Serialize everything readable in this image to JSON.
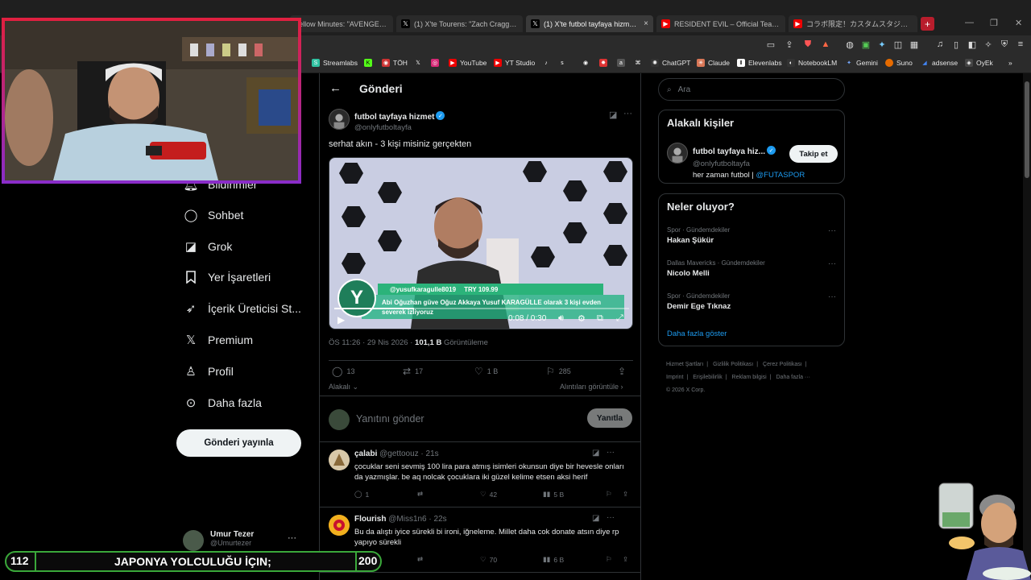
{
  "browser": {
    "tabs": [
      {
        "label": "Yellow Minutes: \"AVENGERS: D",
        "color": "#d33"
      },
      {
        "label": "(1) X'te Tourens: \"Zach Cragger, Resi",
        "color": "#222"
      },
      {
        "label": "(1) X'te futbol tayfaya hizmet: \"s",
        "color": "#222",
        "active": true
      },
      {
        "label": "RESIDENT EVIL – Official Teaser Trail",
        "color": "#e00"
      },
      {
        "label": "コラボ限定！カスタムスタジアムの映像を",
        "color": "#e00"
      }
    ],
    "tab_close": "×",
    "new_tab": "+",
    "bookmarks": [
      {
        "label": "Streamlabs",
        "color": "#31c3a2"
      },
      {
        "label": "TÖH",
        "color": "#c33"
      },
      {
        "label": "",
        "color": "#000"
      },
      {
        "label": "",
        "color": "#d62976"
      },
      {
        "label": "YouTube",
        "color": "#e00"
      },
      {
        "label": "YT Studio",
        "color": "#e00"
      },
      {
        "label": "ChatGPT",
        "color": "#333"
      },
      {
        "label": "Claude",
        "color": "#d97757"
      },
      {
        "label": "Elevenlabs",
        "color": "#333"
      },
      {
        "label": "NotebookLM",
        "color": "#333"
      },
      {
        "label": "Gemini",
        "color": "#4a86e8"
      },
      {
        "label": "Suno",
        "color": "#e66b00"
      },
      {
        "label": "adsense",
        "color": "#4285f4"
      },
      {
        "label": "OyEk",
        "color": "#444"
      }
    ],
    "bookmarks_overflow": "»"
  },
  "nav": {
    "items": [
      {
        "label": "Bildirimler",
        "icon": "🔔"
      },
      {
        "label": "Sohbet",
        "icon": "◯"
      },
      {
        "label": "Grok",
        "icon": "◪"
      },
      {
        "label": "Yer İşaretleri",
        "icon": "⚑"
      },
      {
        "label": "İçerik Üreticisi St...",
        "icon": "➶"
      },
      {
        "label": "Premium",
        "icon": "𝕏"
      },
      {
        "label": "Profil",
        "icon": "♙"
      },
      {
        "label": "Daha fazla",
        "icon": "⊙"
      }
    ],
    "post_button": "Gönderi yayınla",
    "account": {
      "name": "Umur Tezer",
      "handle": "@Umurtezer",
      "more": "···"
    }
  },
  "main": {
    "header_title": "Gönderi",
    "back_icon": "←",
    "post": {
      "author_name": "futbol tayfaya hizmet",
      "author_handle": "@onlyfutboltayfa",
      "text": "serhat akın - 3 kişi misiniz gerçekten",
      "video": {
        "banner_user": "@yusufkaragulle8019",
        "banner_amount": "TRY 109.99",
        "banner_message": "Abi Oğuzhan güve Oğuz Akkaya Yusuf KARAGÜLLE olarak 3 kişi evden severek izliyoruz",
        "banner_letter": "Y",
        "time": "0:08 / 0:30",
        "progress": 0.27
      },
      "timestamp": "ÖS 11:26 · 29 Nis 2026 · ",
      "views_count": "101,1 B",
      "views_label": " Görüntüleme",
      "actions": {
        "replies": "13",
        "reposts": "17",
        "likes": "1 B",
        "bookmarks": "285"
      },
      "relevant_label": "Alakalı ⌄",
      "quotes_link": "Alıntıları görüntüle ›"
    },
    "reply_box": {
      "placeholder": "Yanıtını gönder",
      "button": "Yanıtla"
    },
    "replies": [
      {
        "name": "çalabi",
        "meta": "@gettoouz · 21s",
        "text": "çocuklar seni sevmiş 100 lira para atmış isimleri okunsun diye bir hevesle onları da yazmışlar. be aq nolcak çocuklara iki güzel kelime etsen aksi herif",
        "replies": "1",
        "reposts": "",
        "likes": "42",
        "views": "5 B"
      },
      {
        "name": "Flourish",
        "meta": "@Miss1n6 · 22s",
        "text": "Bu da alıştı iyice sürekli bi ironi, iğneleme. Millet daha cok donate atsın diye rp yapıyo sürekli",
        "replies": "",
        "reposts": "",
        "likes": "70",
        "views": "6 B"
      }
    ]
  },
  "sidebar": {
    "search_placeholder": "Ara",
    "relevant_title": "Alakalı kişiler",
    "relevant_person": {
      "name": "futbol tayfaya hiz...",
      "handle": "@onlyfutboltayfa",
      "bio_prefix": "her zaman futbol | ",
      "bio_mention": "@FUTASPOR",
      "follow": "Takip et"
    },
    "trends_title": "Neler oluyor?",
    "trends": [
      {
        "category": "Spor · Gündemdekiler",
        "name": "Hakan Şükür"
      },
      {
        "category": "Dallas Mavericks · Gündemdekiler",
        "name": "Nicolo Melli"
      },
      {
        "category": "Spor · Gündemdekiler",
        "name": "Demir Ege Tıknaz"
      }
    ],
    "show_more": "Daha fazla göster",
    "footer": [
      "Hizmet Şartları",
      "|",
      "Gizlilik Politikası",
      "|",
      "Çerez Politikası",
      "|",
      "Imprint",
      "|",
      "Erişilebilirlik",
      "|",
      "Reklam bilgisi",
      "|",
      "Daha fazla ···",
      "© 2026 X Corp."
    ]
  },
  "overlay": {
    "ticker_left": "112",
    "ticker_text": "JAPONYA YOLCULUĞU İÇIN;",
    "ticker_right": "200"
  }
}
